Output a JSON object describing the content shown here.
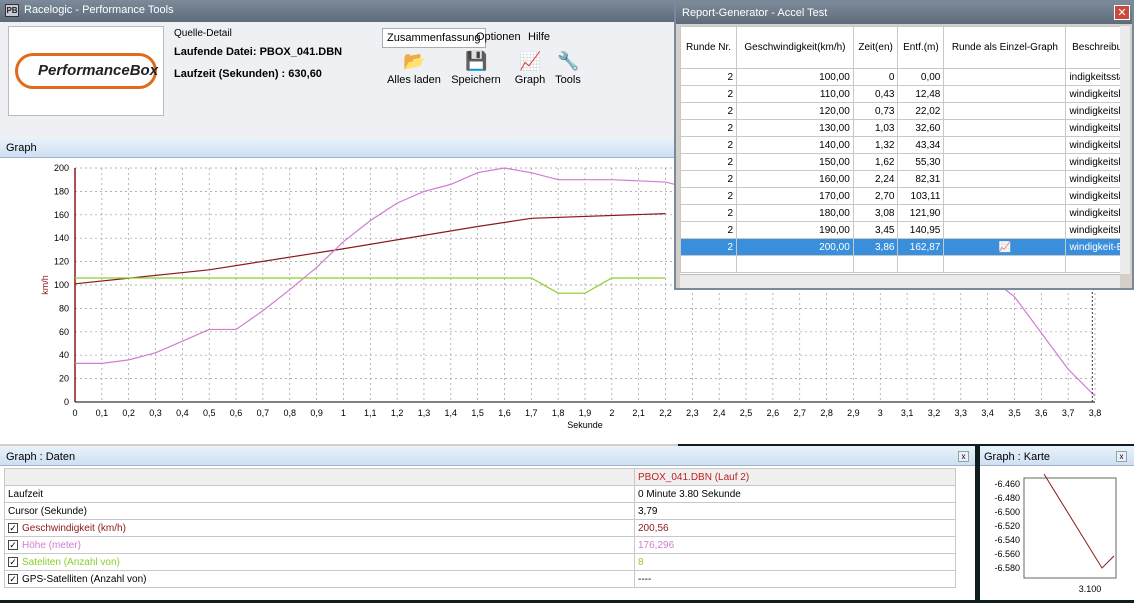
{
  "app": {
    "title": "Racelogic - Performance Tools",
    "icon_letters": "PB"
  },
  "logo": {
    "text": "PerformanceBox"
  },
  "source": {
    "label": "Quelle-Detail",
    "file_line": "Laufende Datei: PBOX_041.DBN",
    "duration_line": "Laufzeit (Sekunden) : 630,60"
  },
  "menu": {
    "summary": "Zusammenfassung",
    "options": "Optionen",
    "help": "Hilfe"
  },
  "toolbar": {
    "load_all": "Alles laden",
    "save": "Speichern",
    "graph": "Graph",
    "tools": "Tools"
  },
  "graph": {
    "title": "Graph"
  },
  "chart_data": {
    "type": "line",
    "xlabel": "Sekunde",
    "ylabel": "km/h",
    "xlim": [
      0,
      3.8
    ],
    "ylim": [
      0,
      200
    ],
    "x_ticks": [
      "0",
      "0,1",
      "0,2",
      "0,3",
      "0,4",
      "0,5",
      "0,6",
      "0,7",
      "0,8",
      "0,9",
      "1",
      "1,1",
      "1,2",
      "1,3",
      "1,4",
      "1,5",
      "1,6",
      "1,7",
      "1,8",
      "1,9",
      "2",
      "2,1",
      "2,2",
      "2,3",
      "2,4",
      "2,5",
      "2,6",
      "2,7",
      "2,8",
      "2,9",
      "3",
      "3,1",
      "3,2",
      "3,3",
      "3,4",
      "3,5",
      "3,6",
      "3,7",
      "3,8"
    ],
    "y_ticks": [
      "0",
      "20",
      "40",
      "60",
      "80",
      "100",
      "120",
      "140",
      "160",
      "180",
      "200"
    ],
    "grid": true,
    "series": [
      {
        "key": "speed",
        "color": "#8b1a1a",
        "x": [
          0,
          0.5,
          1.0,
          1.5,
          1.7,
          2.2
        ],
        "y": [
          101,
          113,
          131,
          150,
          157,
          161
        ]
      },
      {
        "key": "height",
        "color": "#d07cd0",
        "x": [
          0,
          0.1,
          0.2,
          0.3,
          0.4,
          0.5,
          0.6,
          0.7,
          0.8,
          0.9,
          1.0,
          1.1,
          1.2,
          1.3,
          1.4,
          1.5,
          1.6,
          1.7,
          1.8,
          1.9,
          2.0,
          2.2,
          3.3,
          3.5,
          3.7,
          3.8
        ],
        "y": [
          33,
          33,
          36,
          42,
          52,
          62,
          62,
          78,
          96,
          115,
          137,
          155,
          170,
          180,
          186,
          196,
          200,
          196,
          190,
          190,
          190,
          188,
          125,
          90,
          28,
          5
        ]
      },
      {
        "key": "satellites",
        "color": "#8ccf2a",
        "x": [
          0,
          1.7,
          1.8,
          1.9,
          2.0,
          2.2
        ],
        "y": [
          106,
          106,
          93,
          93,
          106,
          106
        ]
      }
    ]
  },
  "data_panel": {
    "title": "Graph : Daten",
    "column_header": "PBOX_041.DBN (Lauf 2)",
    "rows": [
      {
        "label": "Laufzeit",
        "value": "0 Minute 3.80 Sekunde",
        "checkbox": false,
        "color": "#000000"
      },
      {
        "label": "Cursor (Sekunde)",
        "value": "3,79",
        "checkbox": false,
        "color": "#000000"
      },
      {
        "label": "Geschwindigkeit (km/h)",
        "value": "200,56",
        "checkbox": true,
        "color": "#8b1a1a"
      },
      {
        "label": "Höhe (meter)",
        "value": "176,296",
        "checkbox": true,
        "color": "#d07cd0"
      },
      {
        "label": "Sateliten (Anzahl von)",
        "value": "8",
        "checkbox": true,
        "color": "#8ccf2a"
      },
      {
        "label": "GPS-Satelliten (Anzahl von)",
        "value": "----",
        "checkbox": true,
        "color": "#000000"
      }
    ]
  },
  "map_panel": {
    "title": "Graph : Karte",
    "y_ticks": [
      "-6.460",
      "-6.480",
      "-6.500",
      "-6.520",
      "-6.540",
      "-6.560",
      "-6.580"
    ],
    "x_label": "3.100"
  },
  "report": {
    "title": "Report-Generator - Accel Test",
    "close_label": "✕",
    "headers": [
      "Runde Nr.",
      "Geschwindigkeit(km/h)",
      "Zeit(en)",
      "Entf.(m)",
      "Runde als Einzel-Graph",
      "Beschreibung"
    ],
    "rows": [
      [
        "2",
        "100,00",
        "0",
        "0,00",
        "",
        "indigkeitssta"
      ],
      [
        "2",
        "110,00",
        "0,43",
        "12,48",
        "",
        "windigkeitsli"
      ],
      [
        "2",
        "120,00",
        "0,73",
        "22,02",
        "",
        "windigkeitsli"
      ],
      [
        "2",
        "130,00",
        "1,03",
        "32,60",
        "",
        "windigkeitsli"
      ],
      [
        "2",
        "140,00",
        "1,32",
        "43,34",
        "",
        "windigkeitsli"
      ],
      [
        "2",
        "150,00",
        "1,62",
        "55,30",
        "",
        "windigkeitsli"
      ],
      [
        "2",
        "160,00",
        "2,24",
        "82,31",
        "",
        "windigkeitsli"
      ],
      [
        "2",
        "170,00",
        "2,70",
        "103,11",
        "",
        "windigkeitsli"
      ],
      [
        "2",
        "180,00",
        "3,08",
        "121,90",
        "",
        "windigkeitsli"
      ],
      [
        "2",
        "190,00",
        "3,45",
        "140,95",
        "",
        "windigkeitsli"
      ],
      [
        "2",
        "200,00",
        "3,86",
        "162,87",
        "",
        "windigkeit-En"
      ]
    ],
    "selected_row": 10
  },
  "colors": {
    "accent": "#3a8fdc",
    "logo_ring": "#e06c1a"
  }
}
